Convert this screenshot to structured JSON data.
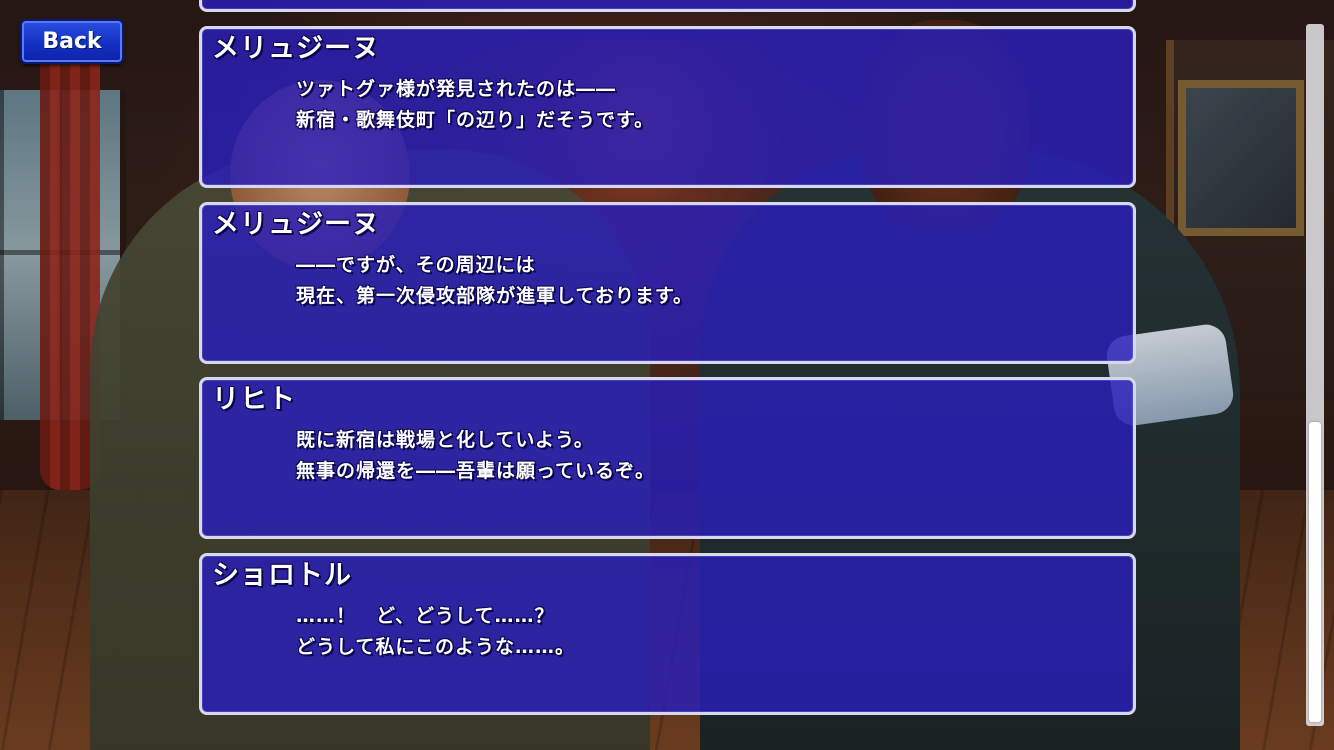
{
  "back_button": {
    "label": "Back"
  },
  "log": {
    "entries": [
      {
        "speaker": "",
        "lines": [
          "",
          ""
        ]
      },
      {
        "speaker": "メリュジーヌ",
        "lines": [
          "ツァトグァ様が発見されたのは――",
          "新宿・歌舞伎町「の辺り」だそうです。"
        ]
      },
      {
        "speaker": "メリュジーヌ",
        "lines": [
          "――ですが、その周辺には",
          "現在、第一次侵攻部隊が進軍しております。"
        ]
      },
      {
        "speaker": "リヒト",
        "lines": [
          "既に新宿は戦場と化していよう。",
          "無事の帰還を――吾輩は願っているぞ。"
        ]
      },
      {
        "speaker": "ショロトル",
        "lines": [
          "……！　ど、どうして……？",
          "どうして私にこのような……。"
        ]
      }
    ]
  },
  "scrollbar": {
    "position_fraction": 0.57
  },
  "colors": {
    "panel_bg": "#281eb9",
    "panel_border": "#d6d8ef",
    "button_blue": "#1430c4",
    "text": "#ffffff"
  }
}
